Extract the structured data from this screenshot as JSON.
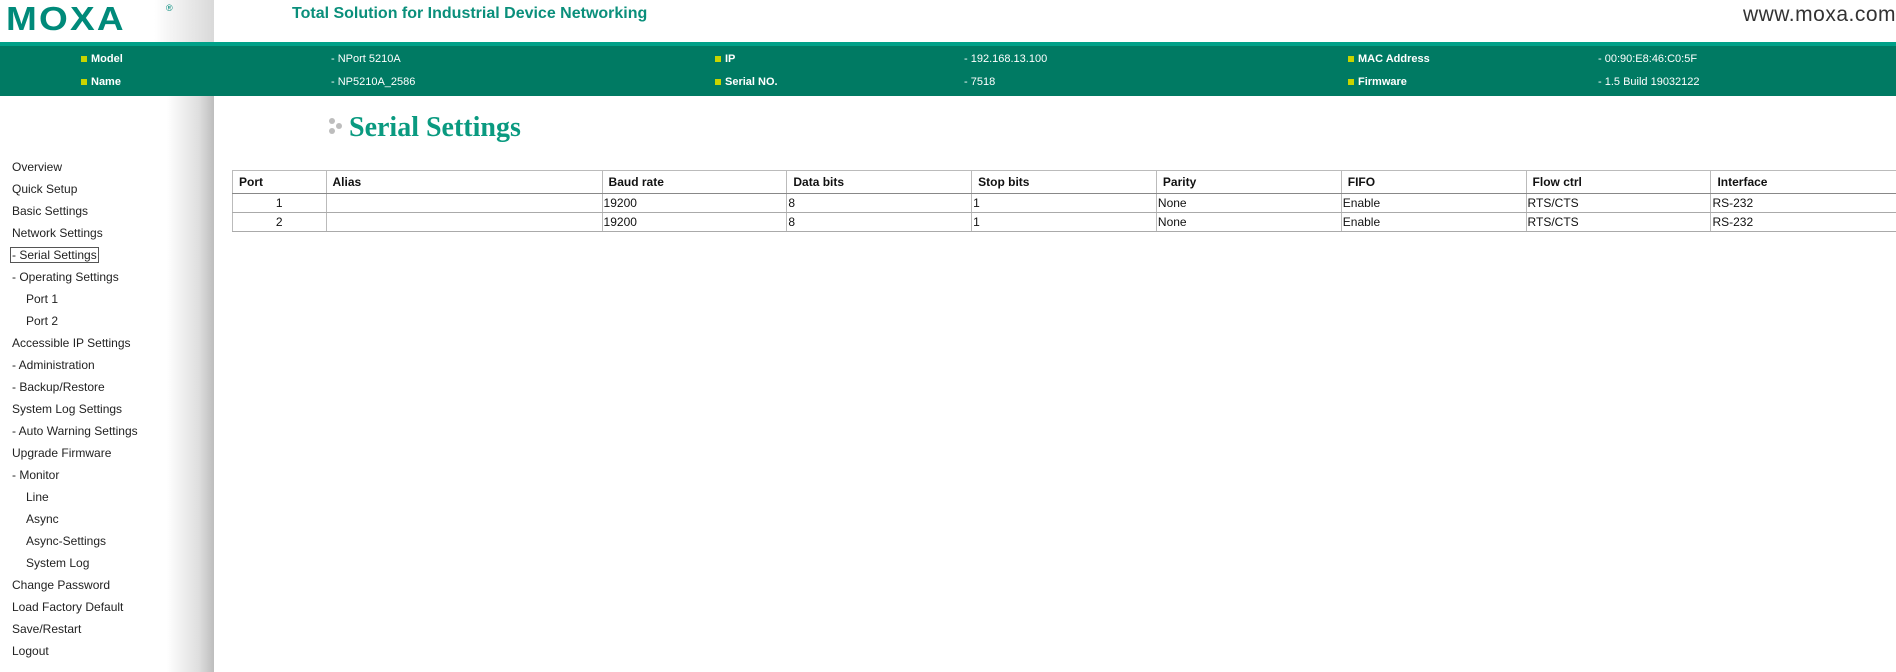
{
  "header": {
    "logo": "MOXA",
    "logo_mark": "®",
    "tagline": "Total Solution for Industrial Device Networking",
    "site_url": "www.moxa.com"
  },
  "device_info": {
    "model_label": "Model",
    "model_value": "- NPort 5210A",
    "name_label": "Name",
    "name_value": "- NP5210A_2586",
    "ip_label": "IP",
    "ip_value": "- 192.168.13.100",
    "serial_label": "Serial NO.",
    "serial_value": "- 7518",
    "mac_label": "MAC Address",
    "mac_value": "- 00:90:E8:46:C0:5F",
    "firmware_label": "Firmware",
    "firmware_value": "- 1.5 Build 19032122"
  },
  "sidebar": {
    "items": [
      {
        "label": "Overview",
        "indent": 0
      },
      {
        "label": "Quick Setup",
        "indent": 0
      },
      {
        "label": "Basic Settings",
        "indent": 0
      },
      {
        "label": "Network Settings",
        "indent": 0
      },
      {
        "label": "- Serial Settings",
        "indent": 0,
        "active": true
      },
      {
        "label": "- Operating Settings",
        "indent": 0
      },
      {
        "label": "Port 1",
        "indent": 1
      },
      {
        "label": "Port 2",
        "indent": 1
      },
      {
        "label": "Accessible IP Settings",
        "indent": 0
      },
      {
        "label": "- Administration",
        "indent": 0
      },
      {
        "label": "- Backup/Restore",
        "indent": 0
      },
      {
        "label": "System Log Settings",
        "indent": 0
      },
      {
        "label": "- Auto Warning Settings",
        "indent": 0
      },
      {
        "label": "Upgrade Firmware",
        "indent": 0
      },
      {
        "label": "- Monitor",
        "indent": 0
      },
      {
        "label": "Line",
        "indent": 1
      },
      {
        "label": "Async",
        "indent": 1
      },
      {
        "label": "Async-Settings",
        "indent": 1
      },
      {
        "label": "System Log",
        "indent": 1
      },
      {
        "label": "Change Password",
        "indent": 0
      },
      {
        "label": "Load Factory Default",
        "indent": 0
      },
      {
        "label": "Save/Restart",
        "indent": 0
      },
      {
        "label": "Logout",
        "indent": 0
      }
    ]
  },
  "main": {
    "title": "Serial Settings",
    "table": {
      "headers": [
        "Port",
        "Alias",
        "Baud rate",
        "Data bits",
        "Stop bits",
        "Parity",
        "FIFO",
        "Flow ctrl",
        "Interface"
      ],
      "rows": [
        [
          "1",
          "",
          "19200",
          "8",
          "1",
          "None",
          "Enable",
          "RTS/CTS",
          "RS-232"
        ],
        [
          "2",
          "",
          "19200",
          "8",
          "1",
          "None",
          "Enable",
          "RTS/CTS",
          "RS-232"
        ]
      ]
    }
  },
  "colors": {
    "brand_green": "#008a7a",
    "infobar_bg": "#007a63",
    "title_green": "#0a9a80",
    "bullet": "#c8d400"
  },
  "icons": {
    "info_bullet": "square-bullet-icon",
    "heading": "dots-icon"
  }
}
